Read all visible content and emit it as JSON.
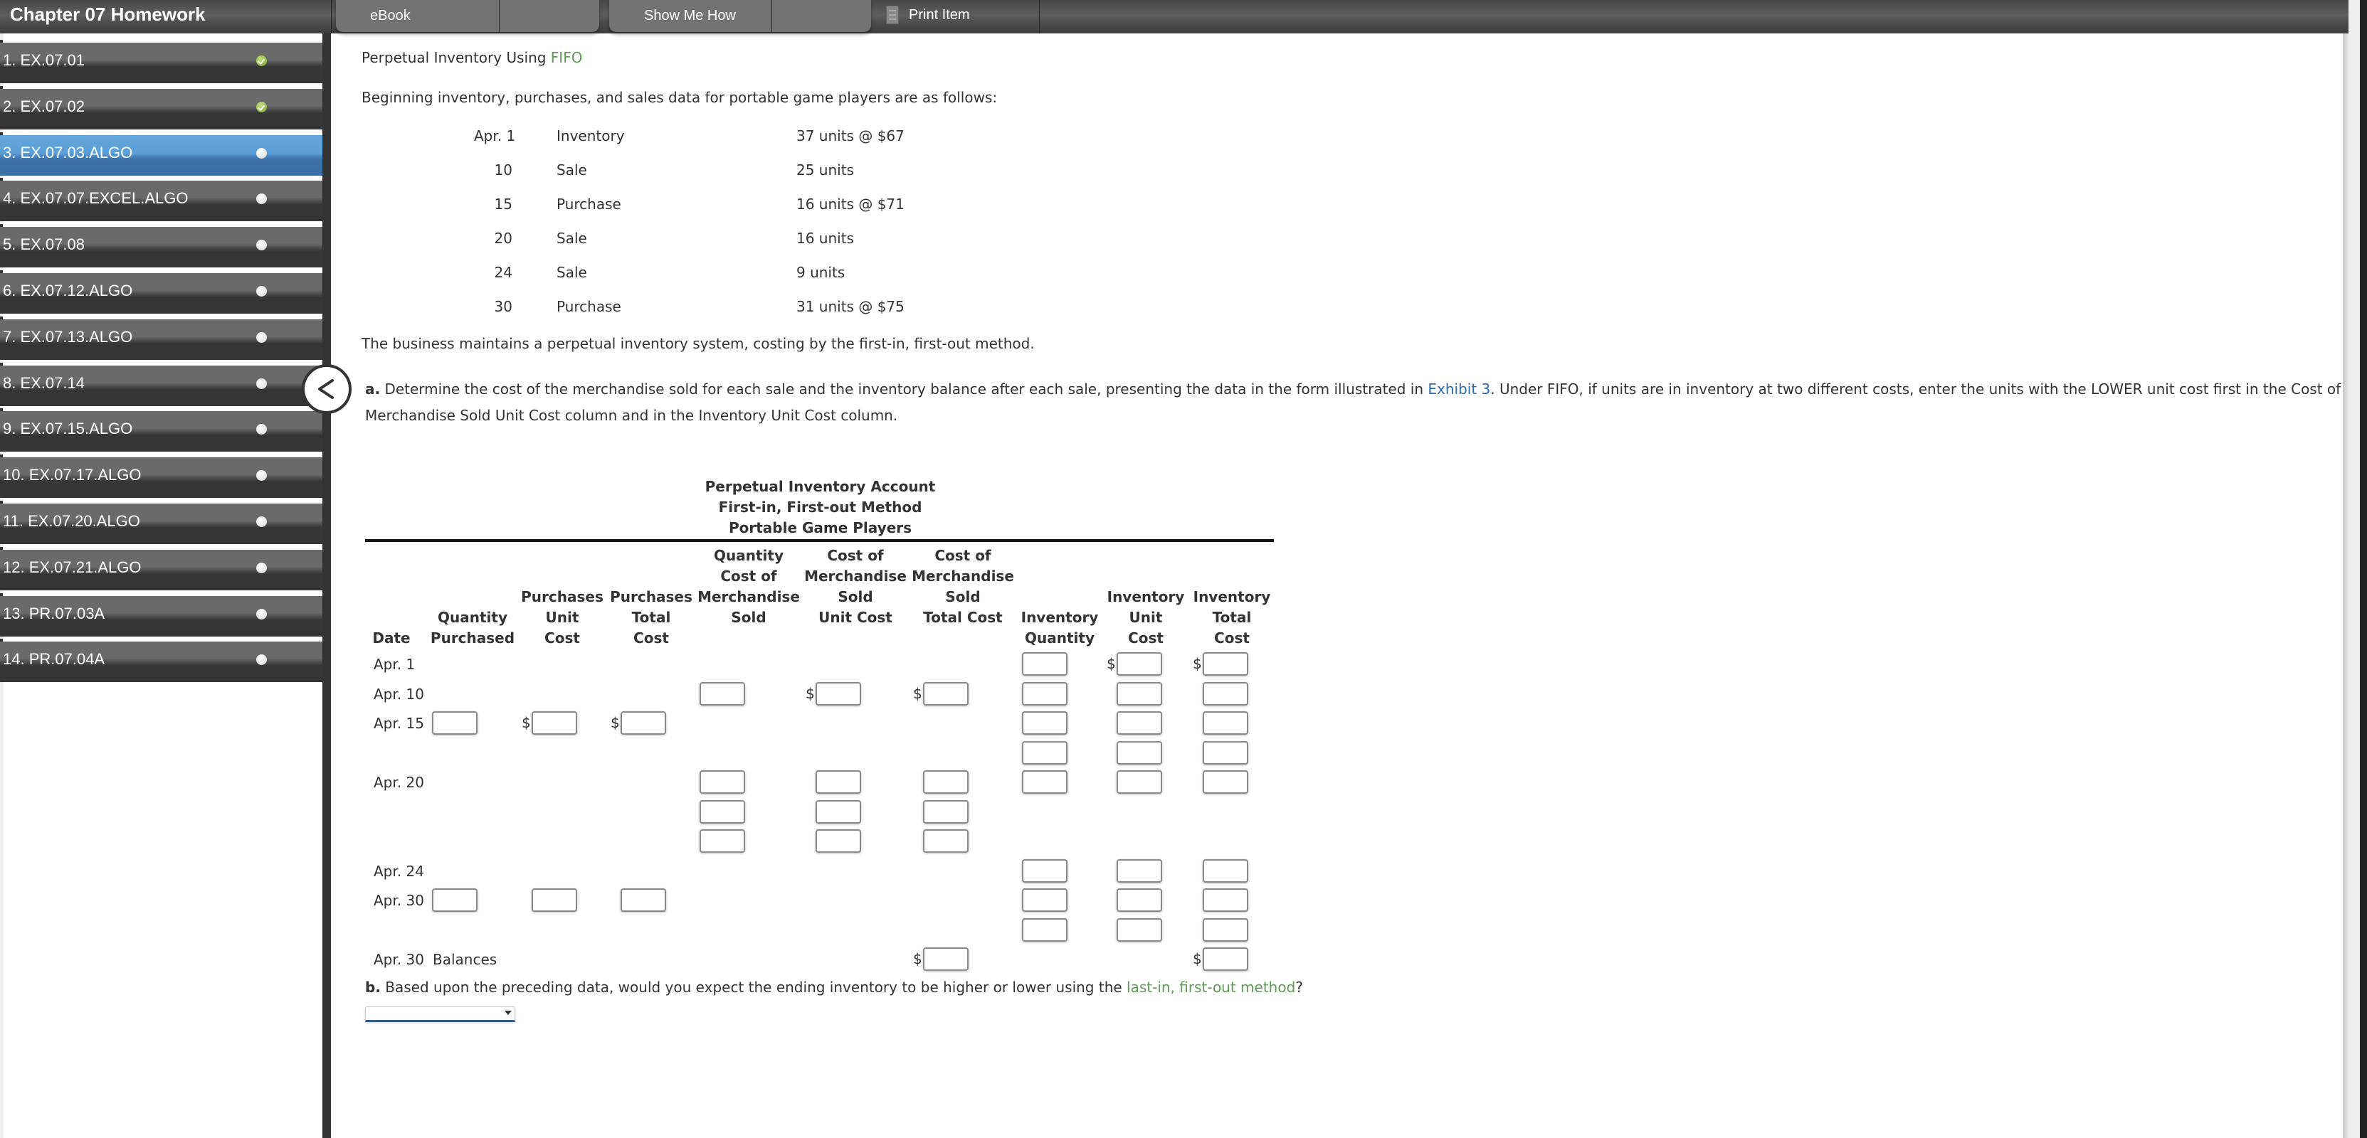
{
  "app": {
    "title": "Chapter 07 Homework"
  },
  "toolbar": {
    "tabs": [
      {
        "label": "eBook"
      },
      {
        "label": "Show Me How"
      }
    ],
    "print_label": "Print Item",
    "print_icon": "print-icon"
  },
  "sidebar": {
    "items": [
      {
        "label": "1. EX.07.01",
        "status": "complete"
      },
      {
        "label": "2. EX.07.02",
        "status": "complete"
      },
      {
        "label": "3. EX.07.03.ALGO",
        "status": "incomplete",
        "active": true
      },
      {
        "label": "4. EX.07.07.EXCEL.ALGO",
        "status": "incomplete"
      },
      {
        "label": "5. EX.07.08",
        "status": "incomplete"
      },
      {
        "label": "6. EX.07.12.ALGO",
        "status": "incomplete"
      },
      {
        "label": "7. EX.07.13.ALGO",
        "status": "incomplete"
      },
      {
        "label": "8. EX.07.14",
        "status": "incomplete"
      },
      {
        "label": "9. EX.07.15.ALGO",
        "status": "incomplete"
      },
      {
        "label": "10. EX.07.17.ALGO",
        "status": "incomplete"
      },
      {
        "label": "11. EX.07.20.ALGO",
        "status": "incomplete"
      },
      {
        "label": "12. EX.07.21.ALGO",
        "status": "incomplete"
      },
      {
        "label": "13. PR.07.03A",
        "status": "incomplete"
      },
      {
        "label": "14. PR.07.04A",
        "status": "incomplete"
      }
    ],
    "collapse_icon": "chevron-left-icon"
  },
  "problem": {
    "title_prefix": "Perpetual Inventory Using ",
    "title_link": "FIFO",
    "intro": "Beginning inventory, purchases, and sales data for portable game players are as follows:",
    "transactions": [
      {
        "date": "Apr. 1",
        "type": "Inventory",
        "detail": "37 units @ $67"
      },
      {
        "date": "10",
        "type": "Sale",
        "detail": "25 units"
      },
      {
        "date": "15",
        "type": "Purchase",
        "detail": "16 units @ $71"
      },
      {
        "date": "20",
        "type": "Sale",
        "detail": "16 units"
      },
      {
        "date": "24",
        "type": "Sale",
        "detail": "9 units"
      },
      {
        "date": "30",
        "type": "Purchase",
        "detail": "31 units @ $75"
      }
    ],
    "method_note": "The business maintains a perpetual inventory system, costing by the first-in, first-out method.",
    "part_a": {
      "label": "a.",
      "text1": " Determine the cost of the merchandise sold for each sale and the inventory balance after each sale, presenting the data in the form illustrated in ",
      "link": "Exhibit 3",
      "text2": ". Under FIFO, if units are in inventory at two different costs, enter the units with the LOWER unit cost first in the Cost of",
      "text3": "Merchandise Sold Unit Cost column and in the Inventory Unit Cost column."
    },
    "part_b": {
      "label": "b.",
      "text": " Based upon the preceding data, would you expect the ending inventory to be higher or lower using the ",
      "link": "last-in, first-out method",
      "end": "?",
      "select_value": ""
    }
  },
  "table": {
    "title": [
      "Perpetual Inventory Account",
      "First-in, First-out Method",
      "Portable Game Players"
    ],
    "headers": {
      "date": [
        "Date"
      ],
      "qty_purchased": [
        "Quantity",
        "Purchased"
      ],
      "purch_unit_cost": [
        "Purchases",
        "Unit",
        "Cost"
      ],
      "purch_total_cost": [
        "Purchases",
        "Total",
        "Cost"
      ],
      "cogs_qty": [
        "Quantity",
        "Cost of",
        "Merchandise",
        "Sold"
      ],
      "cogs_unit_cost": [
        "Cost of",
        "Merchandise",
        "Sold",
        "Unit Cost"
      ],
      "cogs_total_cost": [
        "Cost of",
        "Merchandise",
        "Sold",
        "Total Cost"
      ],
      "inv_qty": [
        "Inventory",
        "Quantity"
      ],
      "inv_unit_cost": [
        "Inventory",
        "Unit",
        "Cost"
      ],
      "inv_total_cost": [
        "Inventory",
        "Total",
        "Cost"
      ]
    },
    "row_labels": [
      "Apr. 1",
      "Apr. 10",
      "Apr. 15",
      "Apr. 20",
      "Apr. 24",
      "Apr. 30",
      "Apr. 30"
    ],
    "balances_label": "Balances",
    "currency_symbol": "$"
  }
}
